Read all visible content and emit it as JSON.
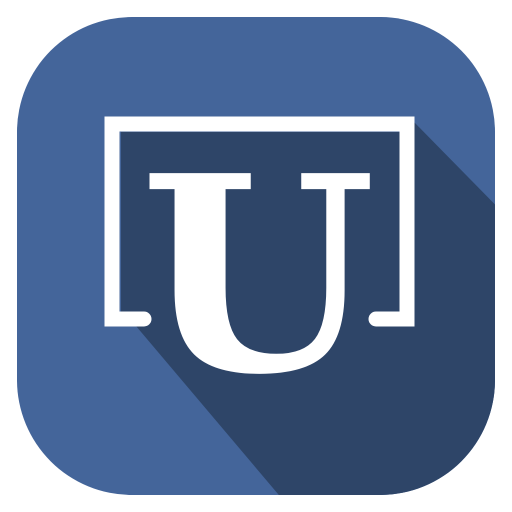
{
  "icon": {
    "letter": "U",
    "colors": {
      "tile": "#44659a",
      "long_shadow": "#2e4568",
      "glyph": "#ffffff"
    }
  }
}
